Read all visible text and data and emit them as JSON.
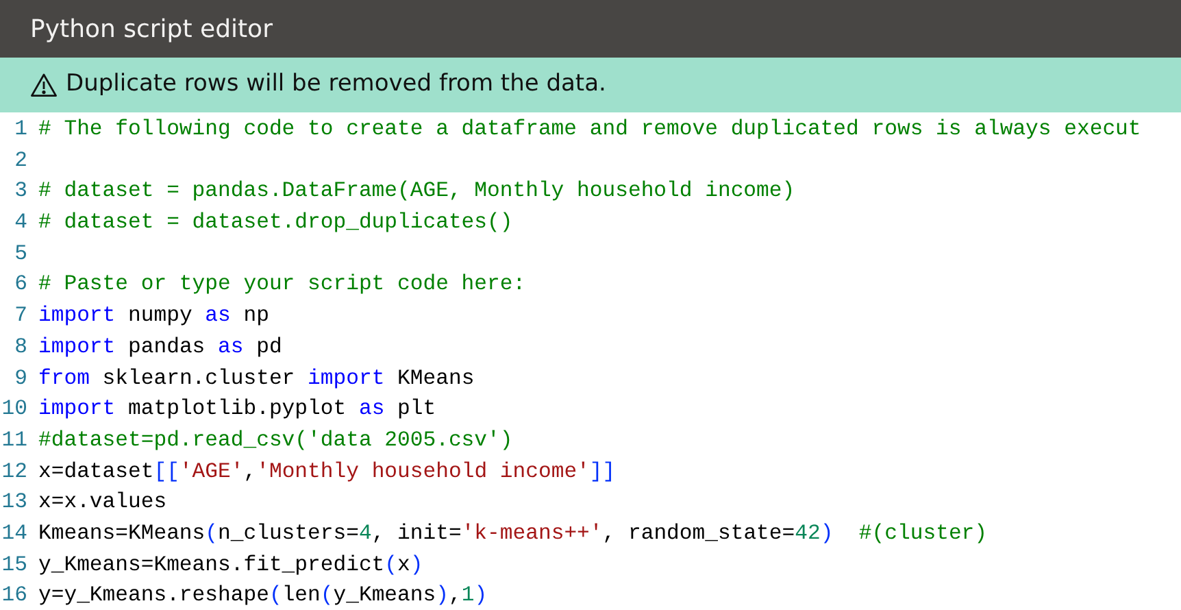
{
  "window": {
    "title": "Python script editor"
  },
  "banner": {
    "text": "Duplicate rows will be removed from the data."
  },
  "editor": {
    "lines": [
      {
        "number": "1",
        "tokens": [
          {
            "kind": "comment",
            "text": "# The following code to create a dataframe and remove duplicated rows is always execut"
          }
        ]
      },
      {
        "number": "2"
      },
      {
        "number": "3",
        "tokens": [
          {
            "kind": "comment",
            "text": "# dataset = pandas.DataFrame(AGE, Monthly household income)"
          }
        ]
      },
      {
        "number": "4",
        "tokens": [
          {
            "kind": "comment",
            "text": "# dataset = dataset.drop_duplicates()"
          }
        ]
      },
      {
        "number": "5"
      },
      {
        "number": "6",
        "tokens": [
          {
            "kind": "comment",
            "text": "# Paste or type your script code here:"
          }
        ]
      },
      {
        "number": "7",
        "tokens": [
          {
            "kind": "keyword",
            "text": "import"
          },
          {
            "kind": "plain",
            "text": " numpy "
          },
          {
            "kind": "keyword",
            "text": "as"
          },
          {
            "kind": "plain",
            "text": " np"
          }
        ]
      },
      {
        "number": "8",
        "tokens": [
          {
            "kind": "keyword",
            "text": "import"
          },
          {
            "kind": "plain",
            "text": " pandas "
          },
          {
            "kind": "keyword",
            "text": "as"
          },
          {
            "kind": "plain",
            "text": " pd"
          }
        ]
      },
      {
        "number": "9",
        "tokens": [
          {
            "kind": "keyword",
            "text": "from"
          },
          {
            "kind": "plain",
            "text": " sklearn.cluster "
          },
          {
            "kind": "keyword",
            "text": "import"
          },
          {
            "kind": "plain",
            "text": " KMeans"
          }
        ]
      },
      {
        "number": "10",
        "tokens": [
          {
            "kind": "keyword",
            "text": "import"
          },
          {
            "kind": "plain",
            "text": " matplotlib.pyplot "
          },
          {
            "kind": "keyword",
            "text": "as"
          },
          {
            "kind": "plain",
            "text": " plt"
          }
        ]
      },
      {
        "number": "11",
        "tokens": [
          {
            "kind": "comment",
            "text": "#dataset=pd.read_csv('data 2005.csv')"
          }
        ]
      },
      {
        "number": "12",
        "tokens": [
          {
            "kind": "plain",
            "text": "x=dataset"
          },
          {
            "kind": "bracket",
            "text": "[["
          },
          {
            "kind": "string",
            "text": "'AGE'"
          },
          {
            "kind": "plain",
            "text": ","
          },
          {
            "kind": "string",
            "text": "'Monthly household income'"
          },
          {
            "kind": "bracket",
            "text": "]]"
          }
        ]
      },
      {
        "number": "13",
        "tokens": [
          {
            "kind": "plain",
            "text": "x=x.values"
          }
        ]
      },
      {
        "number": "14",
        "tokens": [
          {
            "kind": "plain",
            "text": "Kmeans=KMeans"
          },
          {
            "kind": "bracket",
            "text": "("
          },
          {
            "kind": "plain",
            "text": "n_clusters="
          },
          {
            "kind": "number",
            "text": "4"
          },
          {
            "kind": "plain",
            "text": ", init="
          },
          {
            "kind": "string",
            "text": "'k-means++'"
          },
          {
            "kind": "plain",
            "text": ", random_state="
          },
          {
            "kind": "number",
            "text": "42"
          },
          {
            "kind": "bracket",
            "text": ")"
          },
          {
            "kind": "comment",
            "text": "  #(cluster)"
          }
        ]
      },
      {
        "number": "15",
        "tokens": [
          {
            "kind": "plain",
            "text": "y_Kmeans=Kmeans.fit_predict"
          },
          {
            "kind": "bracket",
            "text": "("
          },
          {
            "kind": "plain",
            "text": "x"
          },
          {
            "kind": "bracket",
            "text": ")"
          }
        ]
      },
      {
        "number": "16",
        "tokens": [
          {
            "kind": "plain",
            "text": "y=y_Kmeans.reshape"
          },
          {
            "kind": "bracket",
            "text": "("
          },
          {
            "kind": "plain",
            "text": "len"
          },
          {
            "kind": "bracket",
            "text": "("
          },
          {
            "kind": "plain",
            "text": "y_Kmeans"
          },
          {
            "kind": "bracket",
            "text": ")"
          },
          {
            "kind": "plain",
            "text": ","
          },
          {
            "kind": "number",
            "text": "1"
          },
          {
            "kind": "bracket",
            "text": ")"
          }
        ]
      }
    ]
  }
}
